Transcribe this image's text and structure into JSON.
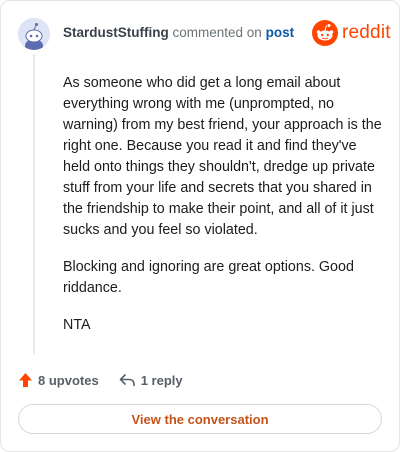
{
  "header": {
    "username": "StardustStuffing",
    "action_text": "commented on",
    "link_text": "post"
  },
  "brand": {
    "wordmark": "reddit",
    "logo_icon": "reddit-snoo-icon",
    "color": "#ff4500"
  },
  "comment": {
    "paragraphs": [
      "As someone who did get a long email about everything wrong with me (unprompted, no warning) from my best friend, your approach is the right one. Because you read it and find they've held onto things they shouldn't, dredge up private stuff from your life and secrets that you shared in the friendship to make their point, and all of it just sucks and you feel so violated.",
      "Blocking and ignoring are great options. Good riddance.",
      "NTA"
    ]
  },
  "actions": {
    "upvotes": "8 upvotes",
    "upvote_icon": "upvote-arrow-icon",
    "replies": "1 reply",
    "reply_icon": "reply-arrow-icon",
    "upvote_color": "#ff4500"
  },
  "cta": {
    "label": "View the conversation",
    "color": "#c4531a"
  }
}
